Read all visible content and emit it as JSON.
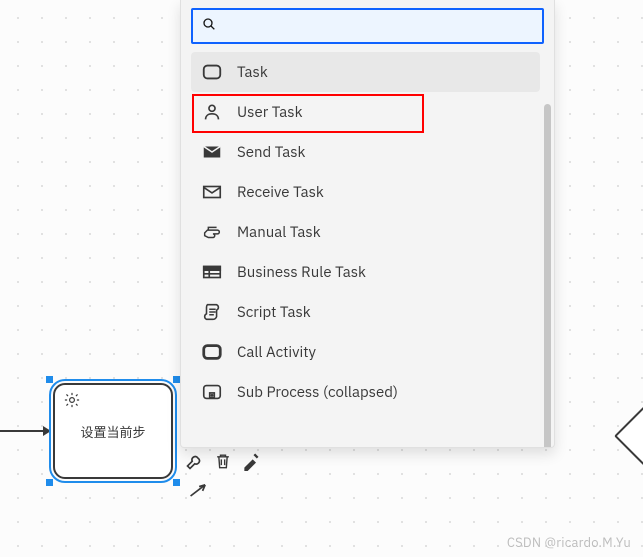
{
  "search": {
    "placeholder": "",
    "value": ""
  },
  "palette": {
    "items": [
      {
        "name": "task",
        "label": "Task"
      },
      {
        "name": "user-task",
        "label": "User Task"
      },
      {
        "name": "send-task",
        "label": "Send Task"
      },
      {
        "name": "receive-task",
        "label": "Receive Task"
      },
      {
        "name": "manual-task",
        "label": "Manual Task"
      },
      {
        "name": "business-rule-task",
        "label": "Business Rule Task"
      },
      {
        "name": "script-task",
        "label": "Script Task"
      },
      {
        "name": "call-activity",
        "label": "Call Activity"
      },
      {
        "name": "sub-process",
        "label": "Sub Process (collapsed)"
      }
    ],
    "hovered_index": 0,
    "highlighted_index": 1
  },
  "canvas": {
    "selected_node_label": "设置当前步"
  },
  "watermarks": {
    "bottom_right": "CSDN @ricardo.M.Yu",
    "faint": ""
  }
}
